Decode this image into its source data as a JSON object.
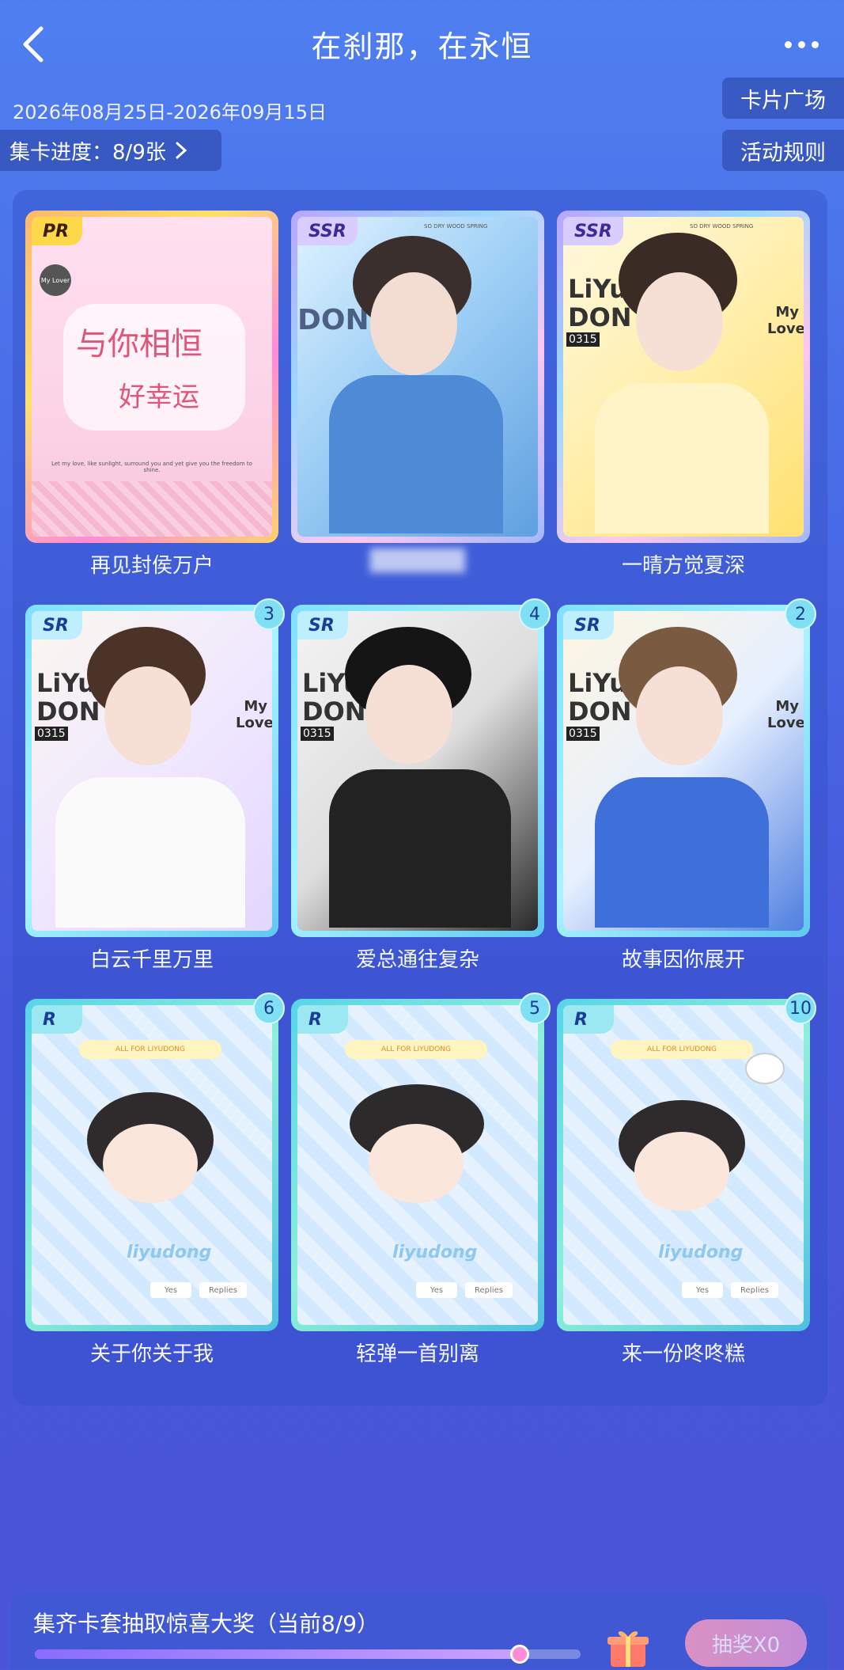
{
  "header": {
    "title": "在刹那，在永恒",
    "dates": "2026年08月25日-2026年09月15日",
    "progress_label": "集卡进度：8/9张",
    "plaza_label": "卡片广场",
    "rules_label": "活动规则"
  },
  "cards": [
    {
      "rarity": "PR",
      "name": "再见封侯万户",
      "count": "",
      "owned": true
    },
    {
      "rarity": "SSR",
      "name": "",
      "count": "",
      "owned": false
    },
    {
      "rarity": "SSR",
      "name": "一晴方觉夏深",
      "count": "",
      "owned": true
    },
    {
      "rarity": "SR",
      "name": "白云千里万里",
      "count": "3",
      "owned": true
    },
    {
      "rarity": "SR",
      "name": "爱总通往复杂",
      "count": "4",
      "owned": true
    },
    {
      "rarity": "SR",
      "name": "故事因你展开",
      "count": "2",
      "owned": true
    },
    {
      "rarity": "R",
      "name": "关于你关于我",
      "count": "6",
      "owned": true
    },
    {
      "rarity": "R",
      "name": "轻弹一首别离",
      "count": "5",
      "owned": true
    },
    {
      "rarity": "R",
      "name": "来一份咚咚糕",
      "count": "10",
      "owned": true
    }
  ],
  "card_art_text": {
    "pr_sticker": "My Lover",
    "pr_script": "与你相恒",
    "pr_script2": "好幸运",
    "pr_footer": "Let my love, like sunlight, surround you and yet give you the freedom to shine.",
    "ssr_top": "SO DRY WOOD SPRING",
    "liyu": "LiYu",
    "don": "DON",
    "my_lover": "My Lover",
    "number": "0315",
    "r_banner": "ALL FOR LIYUDONG",
    "r_name": "liyudong",
    "r_yes": "Yes",
    "r_replies": "Replies"
  },
  "bottom": {
    "title": "集齐卡套抽取惊喜大奖（当前8/9）",
    "draw_label": "抽奖X0",
    "progress_fraction": 0.889
  },
  "colors": {
    "accent": "#4a6ee8",
    "badge": "#7ee0f2",
    "draw_btn": "#ff9fc0"
  }
}
